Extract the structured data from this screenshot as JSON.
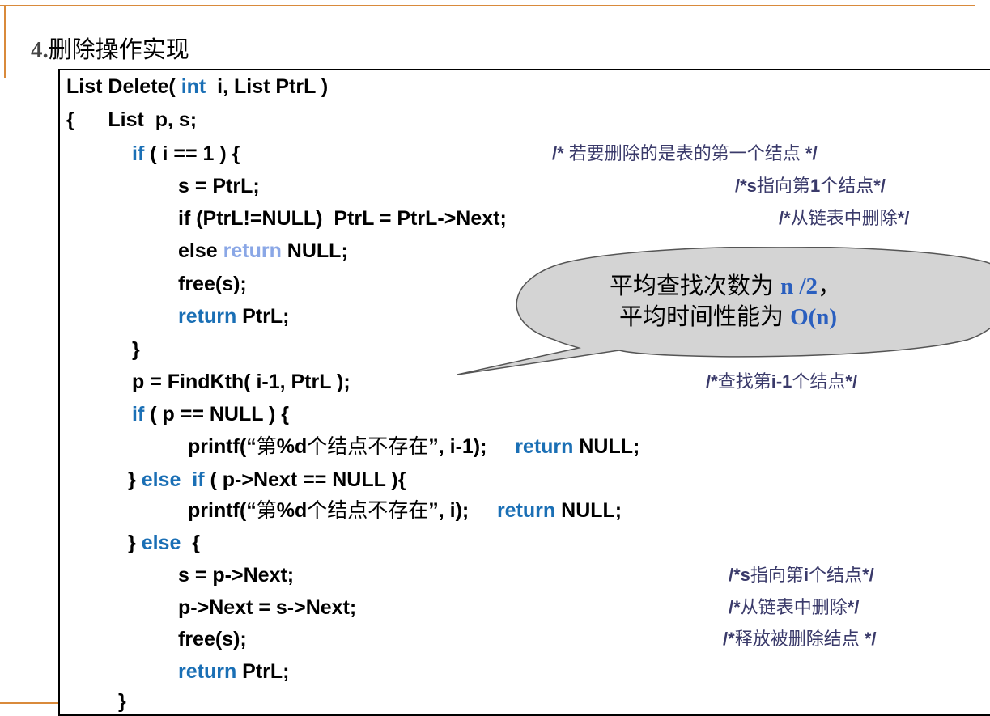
{
  "title": {
    "number": "4.",
    "text": "删除操作实现"
  },
  "code": {
    "l1_a": "List Delete( ",
    "l1_kw": "int",
    "l1_b": "  i, List PtrL )",
    "l2": "{      List  p, s;",
    "l3_kw": "if",
    "l3_b": " ( i == 1 ) {",
    "l4": "s = PtrL;",
    "l5": "if (PtrL!=NULL)  PtrL = PtrL->Next;",
    "l6_a": "else ",
    "l6_kw": "return",
    "l6_b": " NULL;",
    "l7": "free(s);",
    "l8_kw": "return",
    "l8_b": " PtrL;",
    "l9": "}",
    "l10": "p = FindKth( i-1, PtrL );",
    "l11_kw": "if",
    "l11_b": " ( p == NULL ) {",
    "l12_a": "printf(“",
    "l12_cjk1": "第",
    "l12_b": "%d",
    "l12_cjk2": "个结点不存在",
    "l12_c": "”, i-1);     ",
    "l12_kw": "return",
    "l12_d": " NULL;",
    "l13_a": "} ",
    "l13_kw1": "else",
    "l13_b": "  ",
    "l13_kw2": "if",
    "l13_c": " ( p->Next == NULL ){",
    "l14_a": "printf(“",
    "l14_cjk1": "第",
    "l14_b": "%d",
    "l14_cjk2": "个结点不存在",
    "l14_c": "”, i);     ",
    "l14_kw": "return",
    "l14_d": " NULL;",
    "l15_a": "} ",
    "l15_kw": "else",
    "l15_b": "  {",
    "l16": "s = p->Next;",
    "l17": "p->Next = s->Next;",
    "l18": "free(s);",
    "l19_kw": "return",
    "l19_b": " PtrL;",
    "l20": "}"
  },
  "comments": {
    "c1_a": "/* ",
    "c1_cjk": "若要删除的是表的第一个结点",
    "c1_b": " */",
    "c2_a": "/*s",
    "c2_cjk1": "指向第",
    "c2_b": "1",
    "c2_cjk2": "个结点",
    "c2_c": "*/",
    "c3_a": "/*",
    "c3_cjk": "从链表中删除",
    "c3_b": "*/",
    "c4_a": "/*",
    "c4_cjk1": "查找第",
    "c4_b": "i-1",
    "c4_cjk2": "个结点",
    "c4_c": "*/",
    "c5_a": "/*s",
    "c5_cjk1": "指向第",
    "c5_b": "i",
    "c5_cjk2": "个结点",
    "c5_c": "*/",
    "c6_a": "/*",
    "c6_cjk": "从链表中删除",
    "c6_b": "*/",
    "c7_a": "/*",
    "c7_cjk": "释放被删除结点",
    "c7_b": " */"
  },
  "callout": {
    "line1_text": "平均查找次数为 ",
    "line1_value": "n /2",
    "line1_suffix": "，",
    "line2_text": "平均时间性能为 ",
    "line2_value": "O(n)"
  },
  "colors": {
    "keyword": "#1a6fb5",
    "keyword_light": "#8aa7e6",
    "accent_rule": "#d98a3b",
    "callout_fill": "#d4d4d4"
  }
}
